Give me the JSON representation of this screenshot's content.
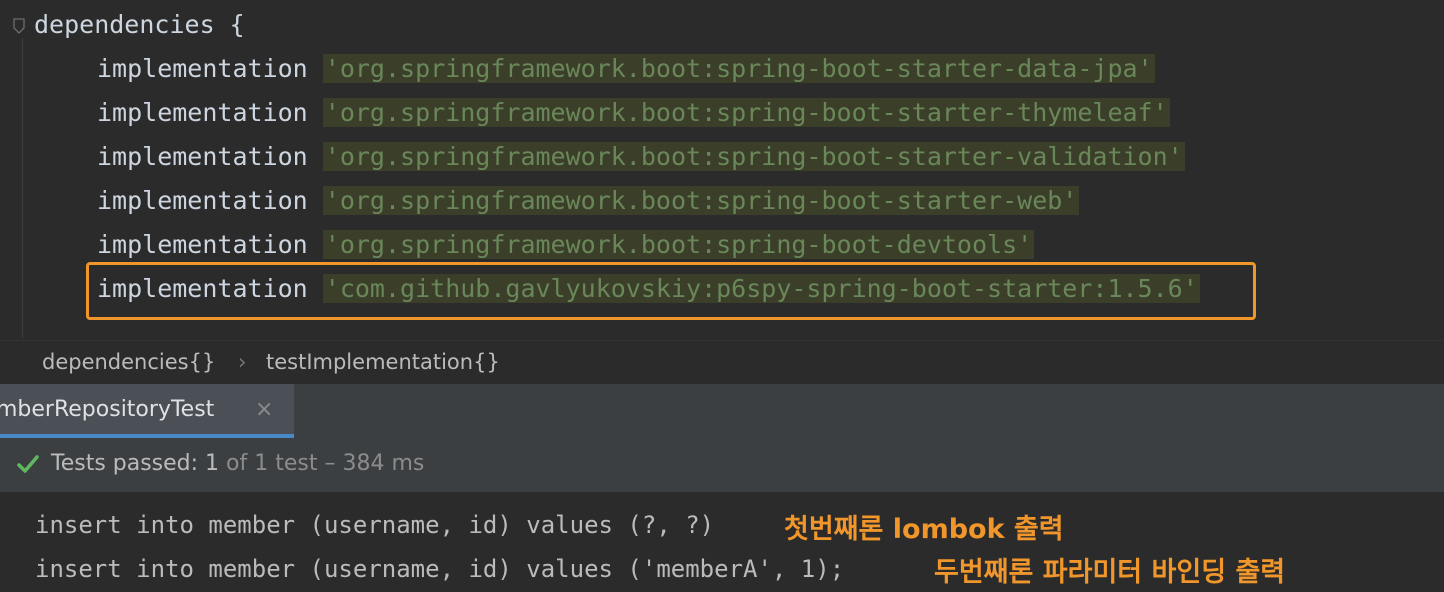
{
  "editor": {
    "block_open": "dependencies {",
    "keyword": "implementation",
    "deps": [
      "'org.springframework.boot:spring-boot-starter-data-jpa'",
      "'org.springframework.boot:spring-boot-starter-thymeleaf'",
      "'org.springframework.boot:spring-boot-starter-validation'",
      "'org.springframework.boot:spring-boot-starter-web'",
      "'org.springframework.boot:spring-boot-devtools'",
      "'com.github.gavlyukovskiy:p6spy-spring-boot-starter:1.5.6'"
    ],
    "highlight_color": "#f0962b"
  },
  "breadcrumb": {
    "items": [
      "dependencies{}",
      "testImplementation{}"
    ],
    "separator": "›"
  },
  "run_tab": {
    "label": "mberRepositoryTest",
    "close": "×"
  },
  "status": {
    "icon": "check-icon",
    "passed_label": "Tests passed: 1",
    "detail": " of 1 test – 384 ms"
  },
  "console": {
    "lines": [
      "insert into member (username, id) values (?, ?)",
      "insert into member (username, id) values ('memberA', 1);"
    ],
    "annotations": [
      "첫번째론 lombok 출력",
      "두번째론 파라미터 바인딩 출력"
    ]
  }
}
